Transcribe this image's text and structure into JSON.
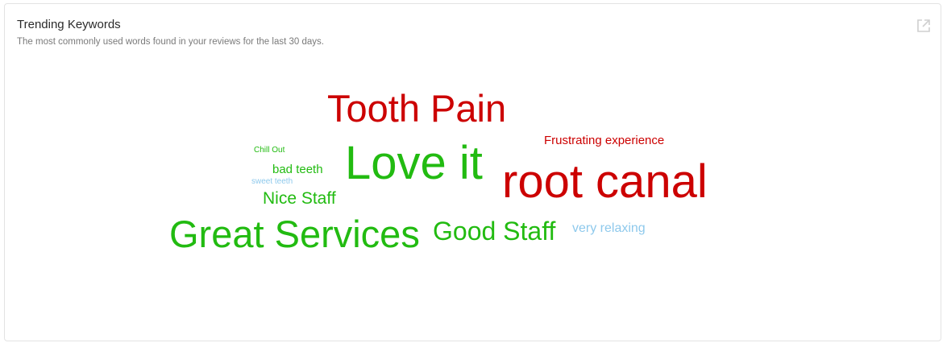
{
  "card": {
    "title": "Trending Keywords",
    "subtitle": "The most commonly used words found in your reviews for the last 30 days.",
    "expand_icon": "external-link-icon"
  },
  "colors": {
    "positive": "#22bb11",
    "negative": "#cc0000",
    "neutral": "#8ec9ec"
  },
  "keywords": [
    {
      "id": "tooth-pain",
      "text": "Tooth Pain",
      "sentiment": "negative"
    },
    {
      "id": "frustrating-experience",
      "text": "Frustrating experience",
      "sentiment": "negative"
    },
    {
      "id": "chill-out",
      "text": "Chill Out",
      "sentiment": "positive"
    },
    {
      "id": "bad-teeth",
      "text": "bad teeth",
      "sentiment": "positive"
    },
    {
      "id": "sweet-teeth",
      "text": "sweet teeth",
      "sentiment": "neutral"
    },
    {
      "id": "nice-staff",
      "text": "Nice Staff",
      "sentiment": "positive"
    },
    {
      "id": "love-it",
      "text": "Love it",
      "sentiment": "positive"
    },
    {
      "id": "root-canal",
      "text": "root canal",
      "sentiment": "negative"
    },
    {
      "id": "great-services",
      "text": "Great Services",
      "sentiment": "positive"
    },
    {
      "id": "good-staff",
      "text": "Good Staff",
      "sentiment": "positive"
    },
    {
      "id": "very-relaxing",
      "text": "very relaxing",
      "sentiment": "neutral"
    }
  ]
}
